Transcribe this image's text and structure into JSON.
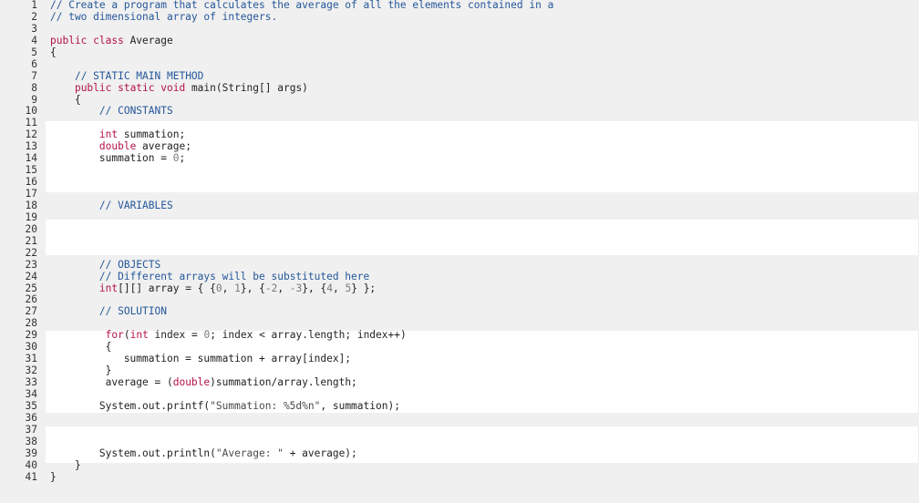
{
  "editor": {
    "lines": [
      {
        "n": "1",
        "tokens": [
          {
            "t": "cm",
            "v": "// Create a program that calculates the average of all the elements contained in a"
          }
        ]
      },
      {
        "n": "2",
        "tokens": [
          {
            "t": "cm",
            "v": "// two dimensional array of integers."
          }
        ]
      },
      {
        "n": "3",
        "tokens": []
      },
      {
        "n": "4",
        "tokens": [
          {
            "t": "kw",
            "v": "public class"
          },
          {
            "t": "tx",
            "v": " Average"
          }
        ]
      },
      {
        "n": "5",
        "tokens": [
          {
            "t": "tx",
            "v": "{"
          }
        ]
      },
      {
        "n": "6",
        "tokens": []
      },
      {
        "n": "7",
        "tokens": [
          {
            "t": "tx",
            "v": "    "
          },
          {
            "t": "cm",
            "v": "// STATIC MAIN METHOD"
          }
        ]
      },
      {
        "n": "8",
        "tokens": [
          {
            "t": "tx",
            "v": "    "
          },
          {
            "t": "kw",
            "v": "public static void"
          },
          {
            "t": "tx",
            "v": " main(String[] args)"
          }
        ]
      },
      {
        "n": "9",
        "tokens": [
          {
            "t": "tx",
            "v": "    {"
          }
        ]
      },
      {
        "n": "10",
        "tokens": [
          {
            "t": "tx",
            "v": "        "
          },
          {
            "t": "cm",
            "v": "// CONSTANTS"
          }
        ]
      },
      {
        "n": "11",
        "tokens": []
      },
      {
        "n": "12",
        "tokens": [
          {
            "t": "tx",
            "v": "        "
          },
          {
            "t": "kw",
            "v": "int"
          },
          {
            "t": "tx",
            "v": " summation;"
          }
        ]
      },
      {
        "n": "13",
        "tokens": [
          {
            "t": "tx",
            "v": "        "
          },
          {
            "t": "kw",
            "v": "double"
          },
          {
            "t": "tx",
            "v": " average;"
          }
        ]
      },
      {
        "n": "14",
        "tokens": [
          {
            "t": "tx",
            "v": "        summation = "
          },
          {
            "t": "num",
            "v": "0"
          },
          {
            "t": "tx",
            "v": ";"
          }
        ]
      },
      {
        "n": "15",
        "tokens": []
      },
      {
        "n": "16",
        "tokens": []
      },
      {
        "n": "17",
        "tokens": []
      },
      {
        "n": "18",
        "tokens": [
          {
            "t": "tx",
            "v": "        "
          },
          {
            "t": "cm",
            "v": "// VARIABLES"
          }
        ]
      },
      {
        "n": "19",
        "tokens": []
      },
      {
        "n": "20",
        "tokens": []
      },
      {
        "n": "21",
        "tokens": []
      },
      {
        "n": "22",
        "tokens": []
      },
      {
        "n": "23",
        "tokens": [
          {
            "t": "tx",
            "v": "        "
          },
          {
            "t": "cm",
            "v": "// OBJECTS"
          }
        ]
      },
      {
        "n": "24",
        "tokens": [
          {
            "t": "tx",
            "v": "        "
          },
          {
            "t": "cm",
            "v": "// Different arrays will be substituted here"
          }
        ]
      },
      {
        "n": "25",
        "tokens": [
          {
            "t": "tx",
            "v": "        "
          },
          {
            "t": "kw",
            "v": "int"
          },
          {
            "t": "tx",
            "v": "[][] array = { {"
          },
          {
            "t": "num",
            "v": "0"
          },
          {
            "t": "tx",
            "v": ", "
          },
          {
            "t": "num",
            "v": "1"
          },
          {
            "t": "tx",
            "v": "}, {"
          },
          {
            "t": "num",
            "v": "-2"
          },
          {
            "t": "tx",
            "v": ", "
          },
          {
            "t": "num",
            "v": "-3"
          },
          {
            "t": "tx",
            "v": "}, {"
          },
          {
            "t": "num",
            "v": "4"
          },
          {
            "t": "tx",
            "v": ", "
          },
          {
            "t": "num",
            "v": "5"
          },
          {
            "t": "tx",
            "v": "} };"
          }
        ]
      },
      {
        "n": "26",
        "tokens": []
      },
      {
        "n": "27",
        "tokens": [
          {
            "t": "tx",
            "v": "        "
          },
          {
            "t": "cm",
            "v": "// SOLUTION"
          }
        ]
      },
      {
        "n": "28",
        "tokens": []
      },
      {
        "n": "29",
        "tokens": [
          {
            "t": "tx",
            "v": "         "
          },
          {
            "t": "kw",
            "v": "for"
          },
          {
            "t": "tx",
            "v": "("
          },
          {
            "t": "kw",
            "v": "int"
          },
          {
            "t": "tx",
            "v": " index = "
          },
          {
            "t": "num",
            "v": "0"
          },
          {
            "t": "tx",
            "v": "; index < array.length; index++)"
          }
        ]
      },
      {
        "n": "30",
        "tokens": [
          {
            "t": "tx",
            "v": "         {"
          }
        ]
      },
      {
        "n": "31",
        "tokens": [
          {
            "t": "tx",
            "v": "            summation = summation + array[index];"
          }
        ]
      },
      {
        "n": "32",
        "tokens": [
          {
            "t": "tx",
            "v": "         }"
          }
        ]
      },
      {
        "n": "33",
        "tokens": [
          {
            "t": "tx",
            "v": "         average = ("
          },
          {
            "t": "kw",
            "v": "double"
          },
          {
            "t": "tx",
            "v": ")summation/array.length;"
          }
        ]
      },
      {
        "n": "34",
        "tokens": []
      },
      {
        "n": "35",
        "tokens": [
          {
            "t": "tx",
            "v": "        System.out.printf("
          },
          {
            "t": "str",
            "v": "\"Summation: %5d%n\""
          },
          {
            "t": "tx",
            "v": ", summation);"
          }
        ]
      },
      {
        "n": "36",
        "tokens": []
      },
      {
        "n": "37",
        "tokens": []
      },
      {
        "n": "38",
        "tokens": []
      },
      {
        "n": "39",
        "tokens": [
          {
            "t": "tx",
            "v": "        System.out.println("
          },
          {
            "t": "str",
            "v": "\"Average: \""
          },
          {
            "t": "tx",
            "v": " + average);"
          }
        ]
      },
      {
        "n": "40",
        "tokens": [
          {
            "t": "tx",
            "v": "    }"
          }
        ]
      },
      {
        "n": "41",
        "tokens": [
          {
            "t": "tx",
            "v": "}"
          }
        ]
      }
    ]
  }
}
